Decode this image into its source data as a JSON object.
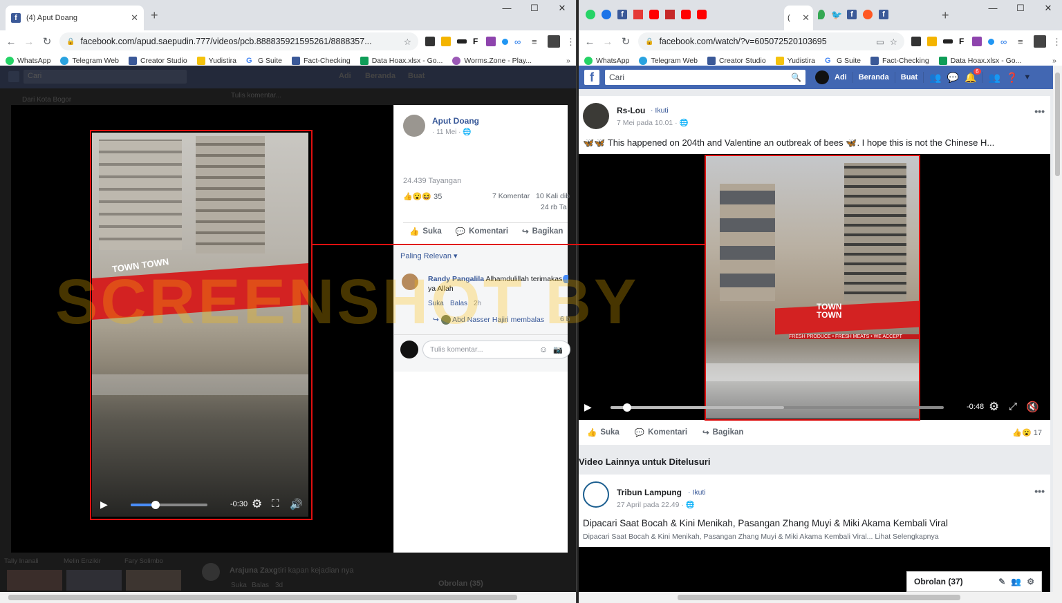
{
  "left_window": {
    "tab_title": "(4) Aput Doang",
    "url": "facebook.com/apud.saepudin.777/videos/pcb.888835921595261/8888357...",
    "bookmarks": [
      "WhatsApp",
      "Telegram Web",
      "Creator Studio",
      "Yudistira",
      "G Suite",
      "Fact-Checking",
      "Data Hoax.xlsx - Go...",
      "Worms.Zone - Play..."
    ],
    "bg_text": {
      "search": "Cari",
      "write": "Tulis komentar...",
      "location": "Dari Kota Bogor",
      "bottom_comment_author": "Arajuna Zaxg",
      "bottom_comment_text": "tiri kapan kejadian nya",
      "suka": "Suka",
      "balas": "Balas",
      "time": "3d",
      "chat": "Obrolan (35)",
      "name1": "Tally Inanali",
      "name2": "Melin Enzikir",
      "name3": "Fary Solimbo",
      "nav_user": "Adi",
      "nav_home": "Beranda",
      "nav_create": "Buat"
    },
    "post": {
      "author": "Aput Doang",
      "date": "11 Mei",
      "views": "24.439 Tayangan",
      "reaction_count": "35",
      "comments": "7 Komentar",
      "shares": "10 Kali dib",
      "views2": "24 rb Ta",
      "like": "Suka",
      "comment": "Komentari",
      "share": "Bagikan",
      "sort": "Paling Relevan",
      "comment1_author": "Randy Pangalila",
      "comment1_text": "Alhamdulillah terimakas ya Allah",
      "comment1_like": "Suka",
      "comment1_reply": "Balas",
      "comment1_time": "2h",
      "reply_author": "Abd Nasser Hajiri membalas",
      "reply_count": "6 b",
      "write_placeholder": "Tulis komentar..."
    },
    "video": {
      "time": "-0:30",
      "progress": 0.32,
      "sign": "TOWN TOWN"
    }
  },
  "right_window": {
    "tab_title": "(",
    "url": "facebook.com/watch/?v=605072520103695",
    "bookmarks": [
      "WhatsApp",
      "Telegram Web",
      "Creator Studio",
      "Yudistira",
      "G Suite",
      "Fact-Checking",
      "Data Hoax.xlsx - Go..."
    ],
    "fb_nav": {
      "search_placeholder": "Cari",
      "user": "Adi",
      "home": "Beranda",
      "create": "Buat",
      "notif_count": "6"
    },
    "post1": {
      "author": "Rs-Lou",
      "follow": "Ikuti",
      "date": "7 Mei pada 10.01",
      "text": "🦋🦋 This happened on 204th and Valentine an outbreak of bees 🦋. I hope this is not the Chinese H...",
      "video_time": "-0:48",
      "video_progress": 0.05,
      "like": "Suka",
      "comment": "Komentari",
      "share": "Bagikan",
      "reactions": "17",
      "sign": "TOWN TOWN",
      "banner": "FRESH PRODUCE • FRESH MEATS • WE ACCEPT"
    },
    "section_title": "Video Lainnya untuk Ditelusuri",
    "post2": {
      "author": "Tribun Lampung",
      "follow": "Ikuti",
      "date": "27 April pada 22.49",
      "title": "Dipacari Saat Bocah & Kini Menikah, Pasangan Zhang Muyi & Miki Akama Kembali Viral",
      "desc": "Dipacari Saat Bocah & Kini Menikah, Pasangan Zhang Muyi & Miki Akama Kembali Viral...",
      "more": "Lihat Selengkapnya"
    },
    "chat": "Obrolan (37)"
  },
  "watermark": "SCREENSHOT BY"
}
